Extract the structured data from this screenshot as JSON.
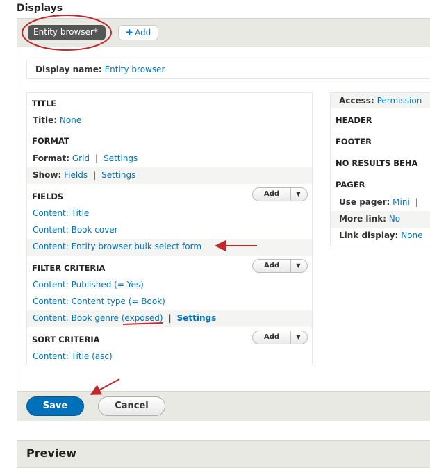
{
  "header": {
    "title": "Displays"
  },
  "tabs": {
    "active_label": "Entity browser*",
    "add_label": "Add"
  },
  "display_name": {
    "label": "Display name:",
    "value": "Entity browser"
  },
  "left": {
    "title": {
      "header": "TITLE",
      "label": "Title:",
      "value": "None"
    },
    "format": {
      "header": "FORMAT",
      "format_label": "Format:",
      "format_value": "Grid",
      "format_settings": "Settings",
      "show_label": "Show:",
      "show_value": "Fields",
      "show_settings": "Settings"
    },
    "fields": {
      "header": "FIELDS",
      "add_label": "Add",
      "items": [
        "Content: Title",
        "Content: Book cover",
        "Content: Entity browser bulk select form"
      ]
    },
    "filter": {
      "header": "FILTER CRITERIA",
      "add_label": "Add",
      "items": [
        "Content: Published (= Yes)",
        "Content: Content type (= Book)"
      ],
      "exposed_item": "Content: Book genre (exposed)",
      "exposed_settings": "Settings"
    },
    "sort": {
      "header": "SORT CRITERIA",
      "add_label": "Add",
      "items": [
        "Content: Title (asc)"
      ]
    }
  },
  "right": {
    "access_label": "Access:",
    "access_value": "Permission",
    "header_label": "HEADER",
    "footer_label": "FOOTER",
    "no_results_label": "NO RESULTS BEHA",
    "pager_header": "PAGER",
    "use_pager_label": "Use pager:",
    "use_pager_value": "Mini",
    "more_link_label": "More link:",
    "more_link_value": "No",
    "link_display_label": "Link display:",
    "link_display_value": "None"
  },
  "actions": {
    "save_label": "Save",
    "cancel_label": "Cancel"
  },
  "preview": {
    "title": "Preview"
  },
  "colors": {
    "link": "#0074bd",
    "save": "#0071b8",
    "annotation": "#c0282d",
    "active_tab": "#555555"
  },
  "icons": {
    "add_display": "plus-icon",
    "dropdown": "caret-down-icon"
  }
}
